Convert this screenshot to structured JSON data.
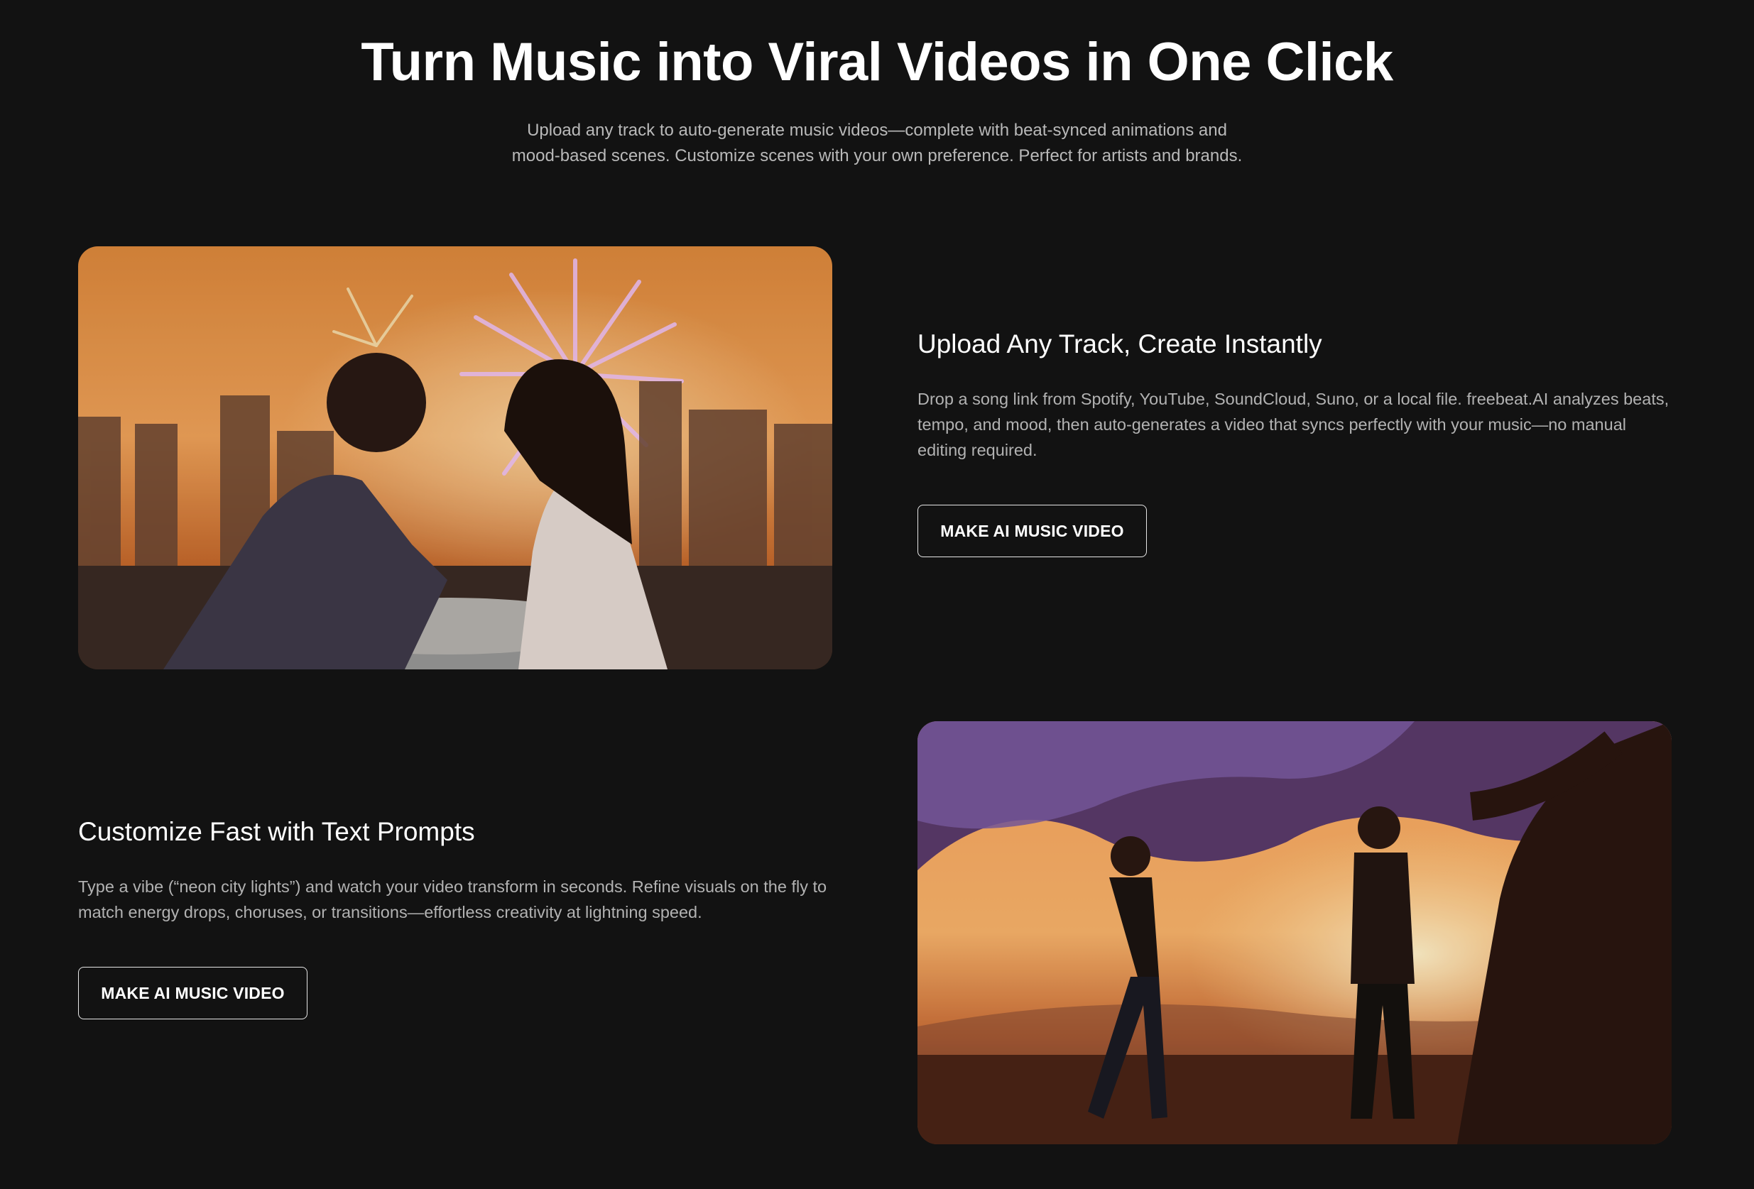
{
  "hero": {
    "title": "Turn Music into Viral Videos in One Click",
    "subtitle": "Upload any track to auto-generate music videos—complete with beat-synced animations and mood-based scenes. Customize scenes with your own preference. Perfect for artists and brands."
  },
  "features": [
    {
      "title": "Upload Any Track, Create Instantly",
      "description": "Drop a song link from Spotify, YouTube, SoundCloud, Suno, or a local file. freebeat.AI analyzes beats, tempo, and mood, then auto-generates a video that syncs perfectly with your music—no manual editing required.",
      "button_label": "MAKE AI MUSIC VIDEO",
      "image": "couple-rooftop-fireworks-sunset"
    },
    {
      "title": "Customize Fast with Text Prompts",
      "description": "Type a vibe (“neon city lights”) and watch your video transform in seconds. Refine visuals on the fly to match energy drops, choruses, or transitions—effortless creativity at lightning speed.",
      "button_label": "MAKE AI MUSIC VIDEO",
      "image": "couple-tree-sunset-field"
    }
  ],
  "colors": {
    "background": "#121212",
    "text": "#ffffff",
    "muted_text": "#b2b2b2",
    "button_border": "#e6e6e6"
  }
}
